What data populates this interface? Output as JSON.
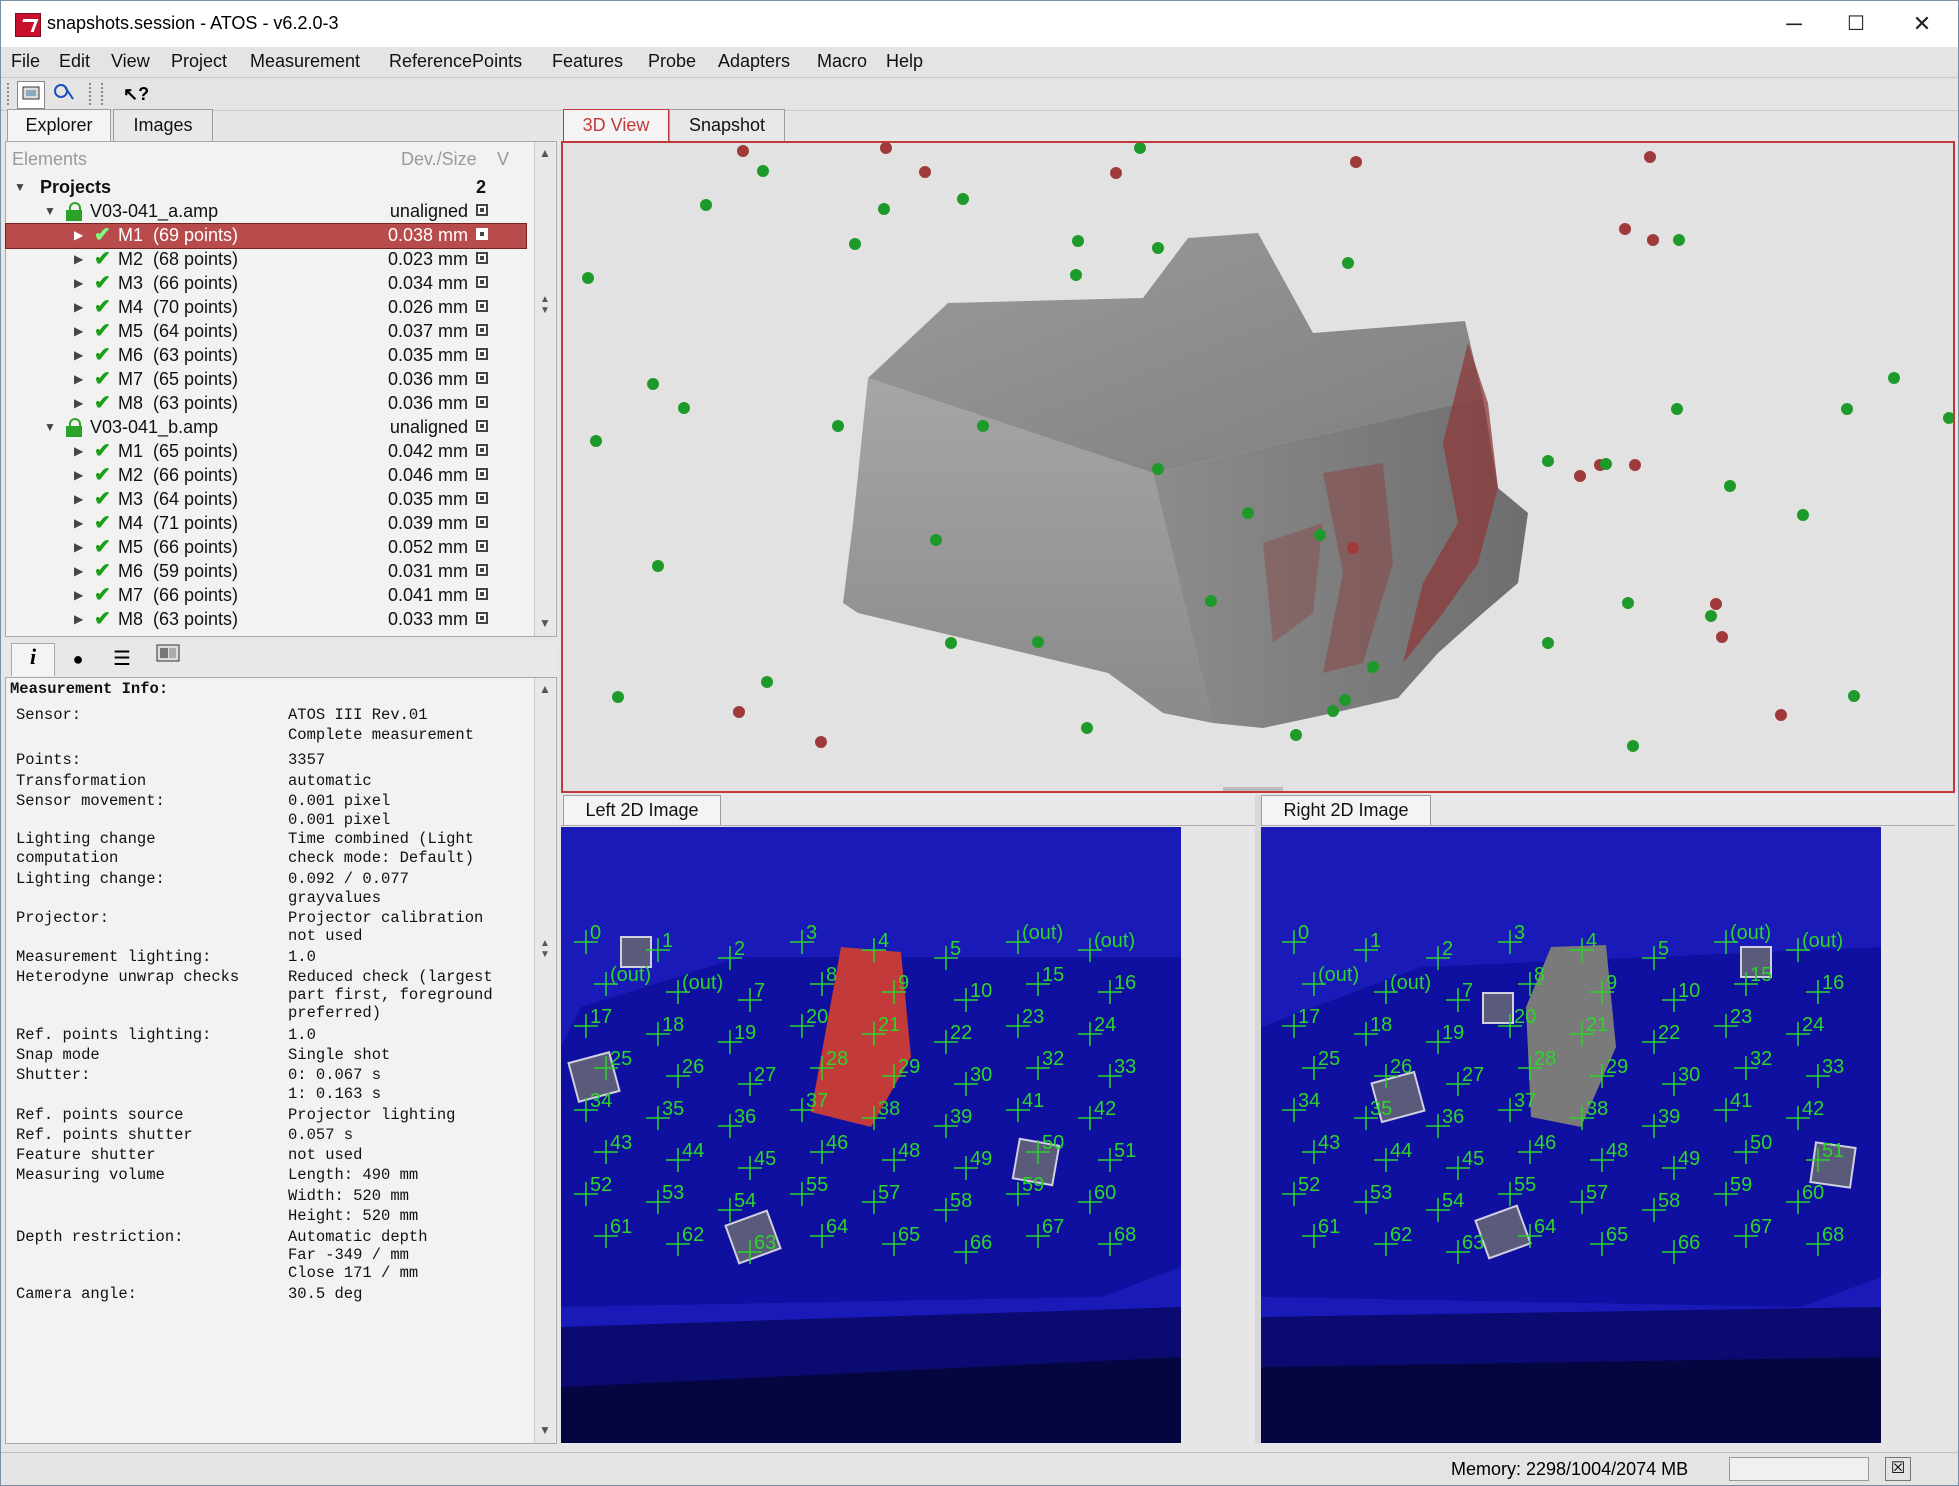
{
  "window": {
    "title": "snapshots.session - ATOS - v6.2.0-3",
    "minimize": "─",
    "maximize": "☐",
    "close": "✕"
  },
  "menu": [
    "File",
    "Edit",
    "View",
    "Project",
    "Measurement",
    "ReferencePoints",
    "Features",
    "Probe",
    "Adapters",
    "Macro",
    "Help"
  ],
  "left_tabs": {
    "explorer": "Explorer",
    "images": "Images"
  },
  "explorer": {
    "col_elements": "Elements",
    "col_dev": "Dev./Size",
    "col_v": "V",
    "projects_label": "Projects",
    "projects_count": "2",
    "projects": [
      {
        "name": "V03-041_a.amp",
        "status": "unaligned",
        "items": [
          {
            "label": "M1  (69 points)",
            "dev": "0.038 mm"
          },
          {
            "label": "M2  (68 points)",
            "dev": "0.023 mm"
          },
          {
            "label": "M3  (66 points)",
            "dev": "0.034 mm"
          },
          {
            "label": "M4  (70 points)",
            "dev": "0.026 mm"
          },
          {
            "label": "M5  (64 points)",
            "dev": "0.037 mm"
          },
          {
            "label": "M6  (63 points)",
            "dev": "0.035 mm"
          },
          {
            "label": "M7  (65 points)",
            "dev": "0.036 mm"
          },
          {
            "label": "M8  (63 points)",
            "dev": "0.036 mm"
          }
        ]
      },
      {
        "name": "V03-041_b.amp",
        "status": "unaligned",
        "items": [
          {
            "label": "M1  (65 points)",
            "dev": "0.042 mm"
          },
          {
            "label": "M2  (66 points)",
            "dev": "0.046 mm"
          },
          {
            "label": "M3  (64 points)",
            "dev": "0.035 mm"
          },
          {
            "label": "M4  (71 points)",
            "dev": "0.039 mm"
          },
          {
            "label": "M5  (66 points)",
            "dev": "0.052 mm"
          },
          {
            "label": "M6  (59 points)",
            "dev": "0.031 mm"
          },
          {
            "label": "M7  (66 points)",
            "dev": "0.041 mm"
          },
          {
            "label": "M8  (63 points)",
            "dev": "0.033 mm"
          }
        ]
      }
    ]
  },
  "info": {
    "heading": "Measurement Info:",
    "rows": [
      {
        "k": "Sensor:",
        "v": "ATOS III Rev.01"
      },
      {
        "k": "",
        "v": "Complete measurement"
      },
      {
        "k": "Points:",
        "v": "3357"
      },
      {
        "k": "Transformation",
        "v": "automatic"
      },
      {
        "k": "Sensor movement:",
        "v": "0.001 pixel"
      },
      {
        "k": "",
        "v": "0.001 pixel"
      },
      {
        "k": "Lighting change",
        "v": "Time combined (Light"
      },
      {
        "k": "computation",
        "v": "check mode: Default)"
      },
      {
        "k": "Lighting change:",
        "v": "0.092 / 0.077"
      },
      {
        "k": "",
        "v": "grayvalues"
      },
      {
        "k": "Projector:",
        "v": "Projector calibration"
      },
      {
        "k": "",
        "v": "not used"
      },
      {
        "k": "Measurement lighting:",
        "v": "1.0"
      },
      {
        "k": "Heterodyne unwrap checks",
        "v": "Reduced check (largest"
      },
      {
        "k": "",
        "v": "part first, foreground"
      },
      {
        "k": "",
        "v": "preferred)"
      },
      {
        "k": "Ref. points lighting:",
        "v": "1.0"
      },
      {
        "k": "Snap mode",
        "v": "Single shot"
      },
      {
        "k": "Shutter:",
        "v": "0: 0.067 s"
      },
      {
        "k": "",
        "v": "1: 0.163 s"
      },
      {
        "k": "Ref. points source",
        "v": "Projector lighting"
      },
      {
        "k": "Ref. points shutter",
        "v": "0.057 s"
      },
      {
        "k": "Feature shutter",
        "v": "not used"
      },
      {
        "k": "Measuring volume",
        "v": "Length: 490 mm"
      },
      {
        "k": "",
        "v": "Width: 520 mm"
      },
      {
        "k": "",
        "v": "Height: 520 mm"
      },
      {
        "k": "Depth restriction:",
        "v": "Automatic depth"
      },
      {
        "k": "",
        "v": "Far -349 / mm"
      },
      {
        "k": "",
        "v": "Close 171 / mm"
      },
      {
        "k": "Camera angle:",
        "v": "30.5 deg"
      }
    ]
  },
  "view_tabs": {
    "view3d": "3D View",
    "snapshot": "Snapshot"
  },
  "left_image_title": "Left 2D Image",
  "right_image_title": "Right 2D Image",
  "point_labels": [
    "0",
    "1",
    "2",
    "3",
    "4",
    "5",
    "(out)",
    "(out)",
    "(out)",
    "(out)",
    "7",
    "8",
    "9",
    "10",
    "15",
    "16",
    "17",
    "18",
    "19",
    "20",
    "21",
    "22",
    "23",
    "24",
    "25",
    "26",
    "27",
    "28",
    "29",
    "30",
    "32",
    "33",
    "34",
    "35",
    "36",
    "37",
    "38",
    "39",
    "41",
    "42",
    "43",
    "44",
    "45",
    "46",
    "48",
    "49",
    "50",
    "51",
    "52",
    "53",
    "54",
    "55",
    "57",
    "58",
    "59",
    "60",
    "61",
    "62",
    "63",
    "64",
    "65",
    "66",
    "67",
    "68"
  ],
  "status": {
    "memory": "Memory: 2298/1004/2074 MB"
  },
  "colors": {
    "accent": "#c0393b",
    "ref_point_green": "#1e9a2a",
    "ref_point_red": "#a03a3a",
    "image_blue": "#1a1ab8",
    "label_green": "#2bd52b"
  }
}
